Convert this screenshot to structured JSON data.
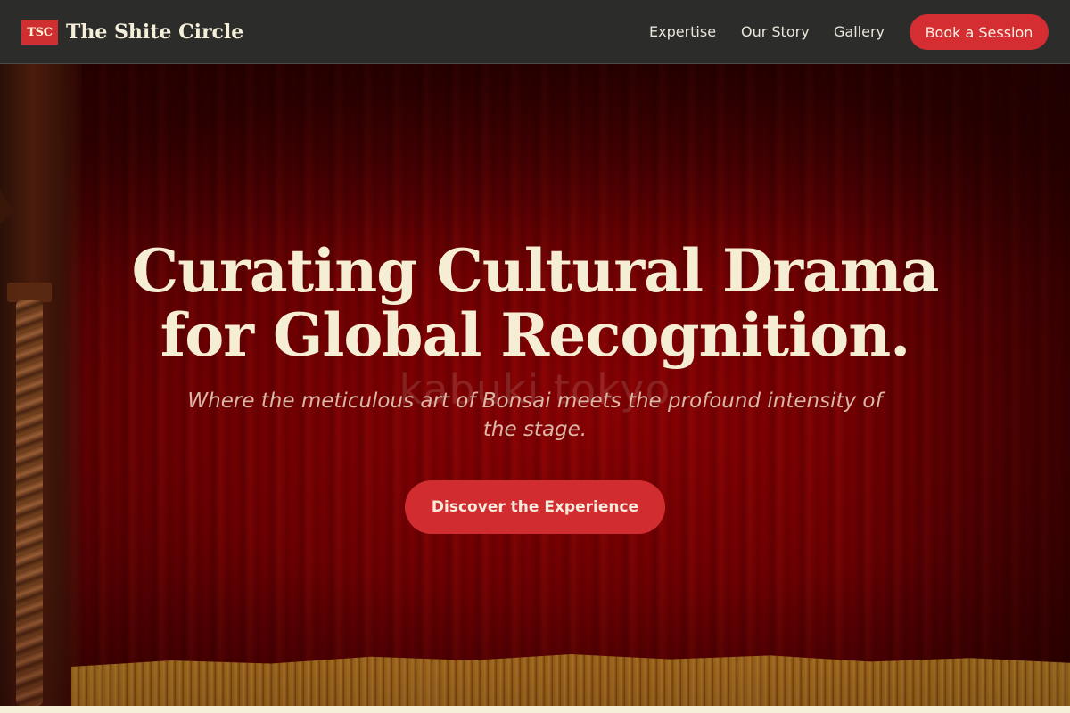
{
  "nav": {
    "logo_text": "TSC",
    "brand_name": "The Shite Circle",
    "links": [
      "Expertise",
      "Our Story",
      "Gallery"
    ],
    "cta_label": "Book a Session"
  },
  "hero": {
    "headline_line1": "Curating Cultural Drama",
    "headline_line2": "for Global Recognition.",
    "watermark": "kabuki tokyo",
    "subtitle": "Where the meticulous art of Bonsai meets the profound intensity of the stage.",
    "button_label": "Discover the Experience"
  },
  "colors": {
    "navbar_bg": "#2c2c2b",
    "accent_red": "#d42e32",
    "headline_cream": "#f6eed4",
    "curtain_red": "#8b0103",
    "page_cream": "#f5efd9"
  }
}
